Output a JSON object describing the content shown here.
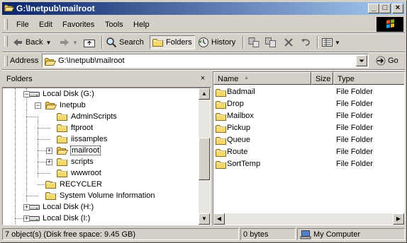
{
  "window": {
    "title": "G:\\Inetpub\\mailroot",
    "minimize": "_",
    "maximize": "□",
    "close": "×"
  },
  "menu": [
    "File",
    "Edit",
    "Favorites",
    "Tools",
    "Help"
  ],
  "toolbar": {
    "back": "Back",
    "search": "Search",
    "folders": "Folders",
    "history": "History"
  },
  "address": {
    "label": "Address",
    "value": "G:\\Inetpub\\mailroot",
    "go": "Go"
  },
  "folders_pane": {
    "title": "Folders",
    "close": "×",
    "tree": [
      {
        "label": "Local Disk (G:)",
        "type": "drive",
        "level": 0,
        "expander": "minus"
      },
      {
        "label": "Inetpub",
        "type": "folder",
        "level": 1,
        "expander": "minus"
      },
      {
        "label": "AdminScripts",
        "type": "folder",
        "level": 2,
        "expander": "none"
      },
      {
        "label": "ftproot",
        "type": "folder",
        "level": 2,
        "expander": "none"
      },
      {
        "label": "iissamples",
        "type": "folder",
        "level": 2,
        "expander": "plus"
      },
      {
        "label": "mailroot",
        "type": "folder-open",
        "level": 2,
        "expander": "plus",
        "selected": true
      },
      {
        "label": "scripts",
        "type": "folder",
        "level": 2,
        "expander": "none"
      },
      {
        "label": "wwwroot",
        "type": "folder",
        "level": 2,
        "expander": "plus"
      },
      {
        "label": "RECYCLER",
        "type": "folder",
        "level": 1,
        "expander": "none"
      },
      {
        "label": "System Volume Information",
        "type": "folder",
        "level": 1,
        "expander": "none"
      },
      {
        "label": "Local Disk (H:)",
        "type": "drive",
        "level": 0,
        "expander": "plus"
      },
      {
        "label": "Local Disk (I:)",
        "type": "drive",
        "level": 0,
        "expander": "plus"
      }
    ]
  },
  "columns": {
    "name": "Name",
    "sort_indicator": "▲",
    "size": "Size",
    "type": "Type"
  },
  "files": [
    {
      "name": "Badmail",
      "size": "",
      "type": "File Folder"
    },
    {
      "name": "Drop",
      "size": "",
      "type": "File Folder"
    },
    {
      "name": "Mailbox",
      "size": "",
      "type": "File Folder"
    },
    {
      "name": "Pickup",
      "size": "",
      "type": "File Folder"
    },
    {
      "name": "Queue",
      "size": "",
      "type": "File Folder"
    },
    {
      "name": "Route",
      "size": "",
      "type": "File Folder"
    },
    {
      "name": "SortTemp",
      "size": "",
      "type": "File Folder"
    }
  ],
  "status": {
    "objects": "7 object(s) (Disk free space: 9.45 GB)",
    "bytes": "0 bytes",
    "zone": "My Computer"
  },
  "colors": {
    "title_start": "#0a246a",
    "title_end": "#a6caf0",
    "face": "#d4d0c8",
    "folder": "#f5d86a"
  }
}
